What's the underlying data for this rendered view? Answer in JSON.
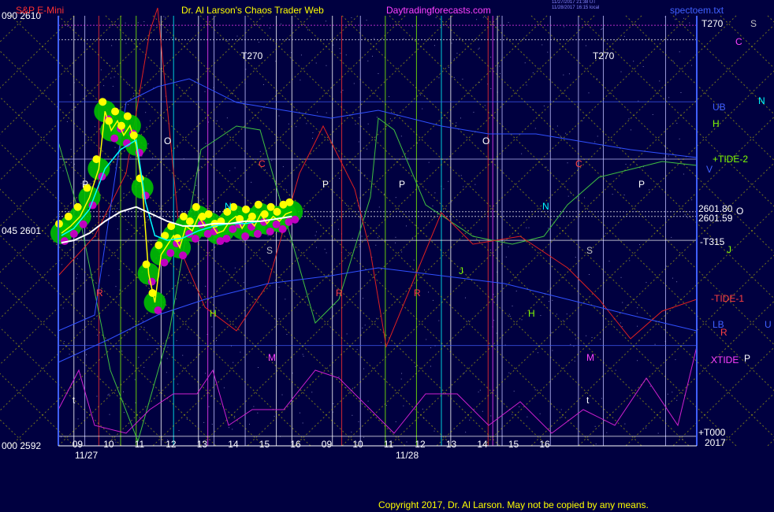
{
  "header": {
    "symbol": "S&P E-Mini",
    "title": "Dr. Al Larson's Chaos Trader Web",
    "site": "Daytradingforecasts.com",
    "stamp_line1": "11/27/2017 21:38 UT",
    "stamp_line2": "11/28/2017 16:15 local",
    "file": "spectoem.txt"
  },
  "colors": {
    "background": "#000040",
    "header_symbol": "#ff3030",
    "header_title": "#ffff00",
    "header_site": "#ff40ff",
    "price_white": "#ffffff",
    "price_cyan": "#00ffff",
    "price_yellow": "#ffff00",
    "green_halo": "#00c000",
    "magenta_dots": "#c000c0"
  },
  "left_axis": [
    {
      "label": "090  2610",
      "value": 2610
    },
    {
      "label": "045  2601",
      "value": 2601
    },
    {
      "label": "000  2592",
      "value": 2592
    }
  ],
  "right_labels": [
    {
      "text": "T270",
      "color": "#ffffff"
    },
    {
      "text": "S",
      "color": "#c0c0c0"
    },
    {
      "text": "C",
      "color": "#ff40ff"
    },
    {
      "text": "N",
      "color": "#00ffff"
    },
    {
      "text": "UB",
      "color": "#4060ff"
    },
    {
      "text": "H",
      "color": "#80ff00"
    },
    {
      "text": "+TIDE-2",
      "color": "#80ff00"
    },
    {
      "text": "V",
      "color": "#4060ff"
    },
    {
      "text": "2601.80",
      "color": "#ffffff"
    },
    {
      "text": "O",
      "color": "#ffffff"
    },
    {
      "text": "2601.59",
      "color": "#ffffff"
    },
    {
      "text": "-T315",
      "color": "#ffffff"
    },
    {
      "text": "J",
      "color": "#80ff00"
    },
    {
      "text": "-TIDE-1",
      "color": "#ff4040"
    },
    {
      "text": "LB",
      "color": "#4060ff"
    },
    {
      "text": "U",
      "color": "#4060ff"
    },
    {
      "text": "R",
      "color": "#ff4040"
    },
    {
      "text": "XTIDE",
      "color": "#ff40ff"
    },
    {
      "text": "P",
      "color": "#ffffff"
    },
    {
      "text": "+T000",
      "color": "#ffffff"
    },
    {
      "text": "2017",
      "color": "#ffffff"
    }
  ],
  "time_axis": {
    "hours": [
      "09",
      "10",
      "11",
      "12",
      "13",
      "14",
      "15",
      "16",
      "09",
      "10",
      "11",
      "12",
      "13",
      "14",
      "15",
      "16"
    ],
    "dates": [
      "11/27",
      "11/28"
    ]
  },
  "chart_labels": [
    {
      "text": "T270",
      "color": "#ffffff"
    },
    {
      "text": "T270",
      "color": "#ffffff"
    },
    {
      "text": "O",
      "color": "#ffffff"
    },
    {
      "text": "O",
      "color": "#ffffff"
    },
    {
      "text": "P",
      "color": "#ffffff"
    },
    {
      "text": "P",
      "color": "#ffffff"
    },
    {
      "text": "P",
      "color": "#ffffff"
    },
    {
      "text": "P",
      "color": "#ffffff"
    },
    {
      "text": "N",
      "color": "#00ffff"
    },
    {
      "text": "N",
      "color": "#00ffff"
    },
    {
      "text": "C",
      "color": "#ff4040"
    },
    {
      "text": "C",
      "color": "#ff4040"
    },
    {
      "text": "H",
      "color": "#80ff00"
    },
    {
      "text": "H",
      "color": "#80ff00"
    },
    {
      "text": "J",
      "color": "#80ff00"
    },
    {
      "text": "S",
      "color": "#c0c0c0"
    },
    {
      "text": "S",
      "color": "#c0c0c0"
    },
    {
      "text": "R",
      "color": "#ff4040"
    },
    {
      "text": "R",
      "color": "#ff4040"
    },
    {
      "text": "R",
      "color": "#ff4040"
    },
    {
      "text": "M",
      "color": "#ff40ff"
    },
    {
      "text": "M",
      "color": "#ff40ff"
    },
    {
      "text": "t",
      "color": "#ffffff"
    },
    {
      "text": "t",
      "color": "#ffffff"
    }
  ],
  "copyright": "Copyright 2017, Dr. Al Larson. May not be copied by any means.",
  "chart_data": {
    "type": "line",
    "title": "S&P E-Mini",
    "y_range": [
      2592,
      2610
    ],
    "x_range_hours": [
      8.5,
      29
    ],
    "ticks_y": [
      2592,
      2601,
      2610
    ],
    "series": [
      {
        "name": "",
        "color": "#ffff00",
        "x": [
          8.6,
          8.9,
          9.2,
          9.5,
          9.8,
          10.0,
          10.2,
          10.4,
          10.6,
          10.8,
          11.0,
          11.2,
          11.4,
          11.6,
          11.8,
          12.0,
          12.2,
          12.4,
          12.6,
          12.8,
          13.0,
          13.2,
          13.4,
          13.6,
          13.8,
          14.0,
          14.2,
          14.4,
          14.6,
          14.8,
          15.0,
          15.2,
          15.4,
          15.6,
          15.8,
          16.0
        ],
        "y": [
          2600.9,
          2601.2,
          2601.6,
          2602.4,
          2603.6,
          2606.0,
          2605.2,
          2605.6,
          2605.0,
          2605.4,
          2604.6,
          2602.8,
          2599.2,
          2598.0,
          2600.0,
          2600.4,
          2600.8,
          2600.3,
          2601.2,
          2601.0,
          2601.6,
          2601.2,
          2601.3,
          2600.9,
          2601.0,
          2601.4,
          2601.6,
          2601.1,
          2601.5,
          2601.2,
          2601.7,
          2601.3,
          2601.6,
          2601.4,
          2601.7,
          2601.8
        ]
      },
      {
        "name": "",
        "color": "#00ffff",
        "x": [
          8.6,
          9.0,
          9.5,
          10.0,
          10.5,
          11.0,
          11.3,
          11.6,
          12.0,
          12.5,
          13.0,
          13.5,
          14.0,
          14.5,
          15.0,
          15.5,
          16.0
        ],
        "y": [
          2600.8,
          2601.1,
          2601.9,
          2603.6,
          2604.4,
          2604.8,
          2602.2,
          2600.8,
          2600.6,
          2600.7,
          2601.0,
          2601.2,
          2601.3,
          2601.3,
          2601.4,
          2601.5,
          2601.6
        ]
      },
      {
        "name": "",
        "color": "#ffffff",
        "x": [
          8.6,
          9.0,
          9.5,
          10.0,
          10.5,
          11.0,
          11.5,
          12.0,
          12.5,
          13.0,
          13.5,
          14.0,
          14.5,
          15.0,
          15.5,
          16.0
        ],
        "y": [
          2600.5,
          2600.6,
          2600.9,
          2601.4,
          2601.8,
          2602.0,
          2601.7,
          2601.4,
          2601.2,
          2601.2,
          2601.3,
          2601.3,
          2601.4,
          2601.4,
          2601.5,
          2601.6
        ]
      }
    ]
  }
}
